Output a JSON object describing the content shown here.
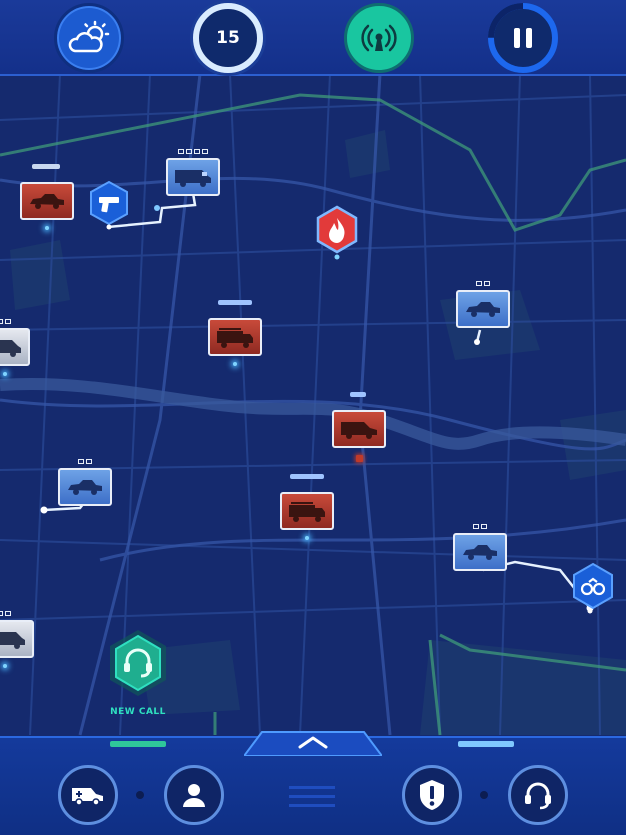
{
  "top_bar": {
    "weather_icon": "partly-cloudy-icon",
    "counter_value": "15",
    "radio_icon": "radio-broadcast-icon",
    "pause_icon": "pause-icon",
    "pause_progress": 0.75
  },
  "map": {
    "incidents": [
      {
        "type": "gun-incident",
        "icon": "gun-icon",
        "color": "#1a5fd8"
      },
      {
        "type": "fire-incident",
        "icon": "flame-icon",
        "color": "#e23a3a"
      },
      {
        "type": "arrest-incident",
        "icon": "handcuffs-icon",
        "color": "#1a5fd8"
      }
    ],
    "vehicles": [
      {
        "kind": "police-car",
        "status": "busy"
      },
      {
        "kind": "police-van",
        "status": "dispatched"
      },
      {
        "kind": "police-van",
        "status": "available"
      },
      {
        "kind": "fire-truck",
        "status": "busy"
      },
      {
        "kind": "police-car",
        "status": "dispatched"
      },
      {
        "kind": "ambulance",
        "status": "busy"
      },
      {
        "kind": "police-car",
        "status": "dispatched"
      },
      {
        "kind": "fire-truck",
        "status": "busy"
      },
      {
        "kind": "police-car",
        "status": "dispatched"
      },
      {
        "kind": "police-van",
        "status": "available"
      }
    ]
  },
  "new_call": {
    "label": "NEW CALL",
    "icon": "headset-icon",
    "color": "#2fe0c0"
  },
  "bottom_bar": {
    "vehicles_button_icon": "ambulance-icon",
    "units_button_icon": "person-icon",
    "menu_icon": "menu-icon",
    "alerts_button_icon": "alert-shield-icon",
    "calls_button_icon": "headset-icon",
    "expand_icon": "chevron-up-icon"
  },
  "colors": {
    "map_bg": "#152a6e",
    "accent": "#2fe0c0",
    "bar_blue": "#1a3a9a"
  }
}
